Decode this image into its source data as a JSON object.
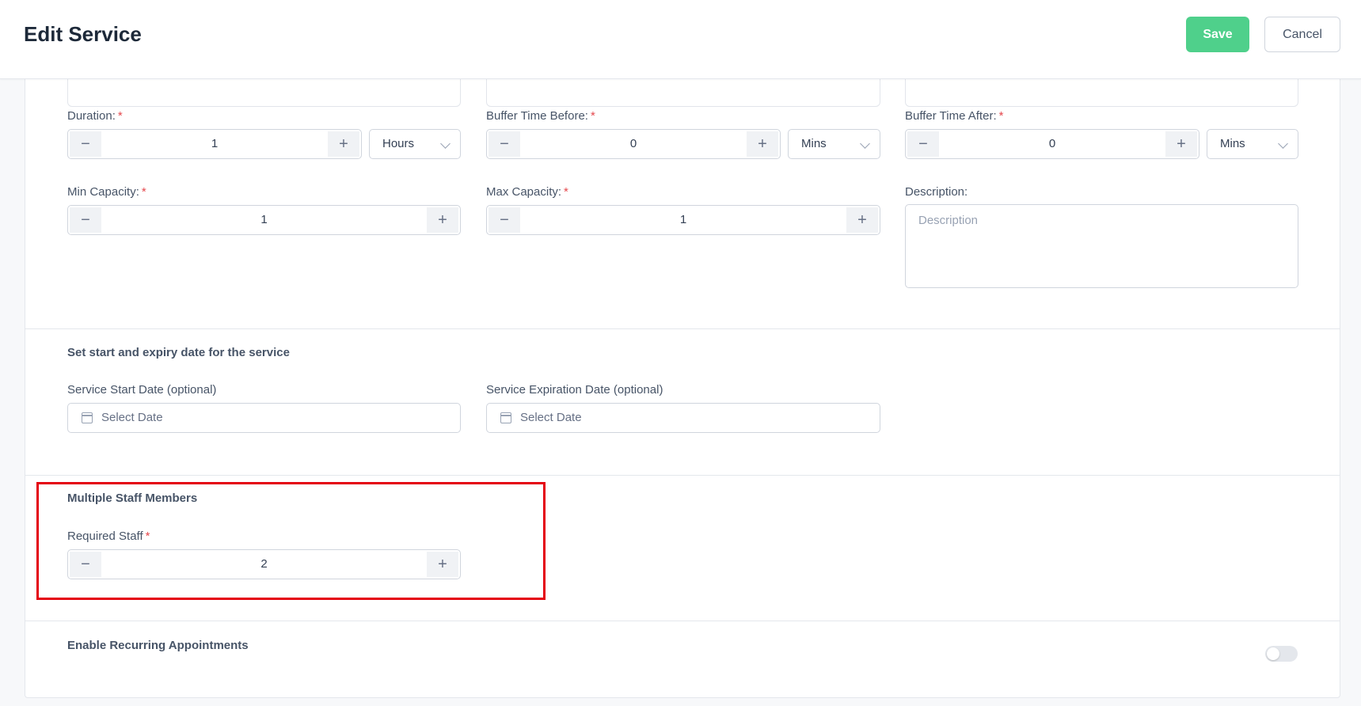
{
  "header": {
    "title": "Edit Service",
    "save_label": "Save",
    "cancel_label": "Cancel"
  },
  "duration": {
    "label": "Duration:",
    "required": "*",
    "value": "1",
    "unit": "Hours"
  },
  "buffer_before": {
    "label": "Buffer Time Before:",
    "required": "*",
    "value": "0",
    "unit": "Mins"
  },
  "buffer_after": {
    "label": "Buffer Time After:",
    "required": "*",
    "value": "0",
    "unit": "Mins"
  },
  "min_capacity": {
    "label": "Min Capacity:",
    "required": "*",
    "value": "1"
  },
  "max_capacity": {
    "label": "Max Capacity:",
    "required": "*",
    "value": "1"
  },
  "description": {
    "label": "Description:",
    "placeholder": "Description"
  },
  "dates": {
    "section_title": "Set start and expiry date for the service",
    "start_label": "Service Start Date (optional)",
    "start_placeholder": "Select Date",
    "end_label": "Service Expiration Date (optional)",
    "end_placeholder": "Select Date"
  },
  "staff": {
    "section_title": "Multiple Staff Members",
    "label": "Required Staff",
    "required": "*",
    "value": "2"
  },
  "recurring": {
    "label": "Enable Recurring Appointments",
    "enabled": false
  },
  "icons": {
    "minus": "−",
    "plus": "+"
  },
  "colors": {
    "save": "#4fd08b",
    "required": "#e5484d",
    "highlight": "#e4000f"
  }
}
